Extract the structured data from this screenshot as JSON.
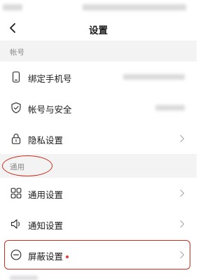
{
  "nav": {
    "title": "设置"
  },
  "sections": [
    {
      "label": "帐号",
      "items": [
        {
          "label": "绑定手机号",
          "icon": "phone-icon"
        },
        {
          "label": "帐号与安全",
          "icon": "shield-check-icon"
        },
        {
          "label": "隐私设置",
          "icon": "lock-icon"
        }
      ]
    },
    {
      "label": "通用",
      "items": [
        {
          "label": "通用设置",
          "icon": "grid-icon"
        },
        {
          "label": "通知设置",
          "icon": "speaker-icon"
        },
        {
          "label": "屏蔽设置",
          "icon": "block-icon",
          "badge": "red-dot"
        }
      ]
    }
  ],
  "colors": {
    "annotation": "#c8301f",
    "badge": "#e53935",
    "section_bg": "#f3f3f3"
  }
}
